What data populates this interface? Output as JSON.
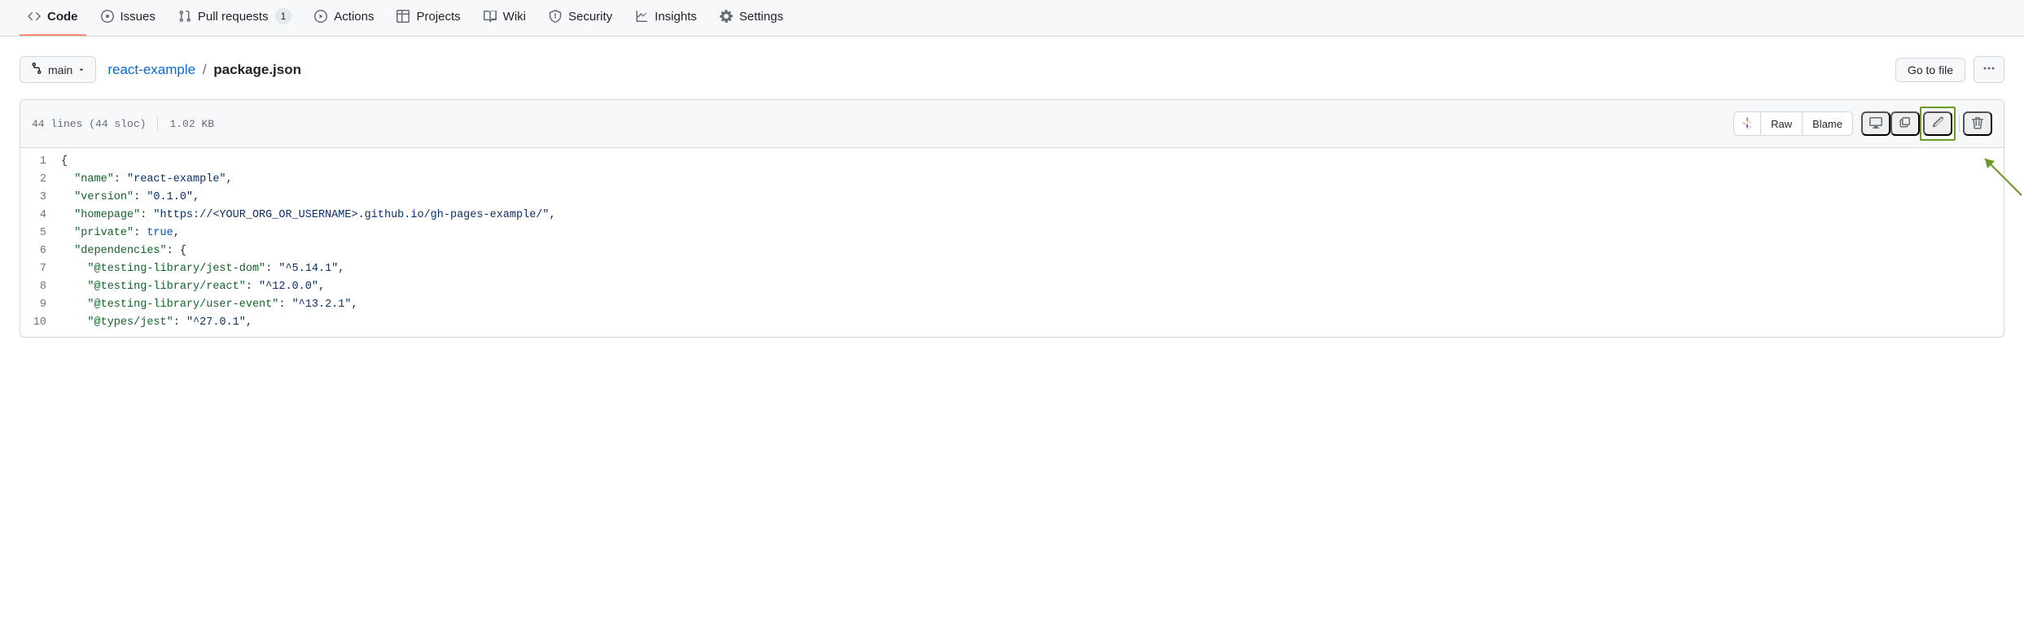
{
  "tabs": {
    "code": "Code",
    "issues": "Issues",
    "pulls": "Pull requests",
    "pulls_count": "1",
    "actions": "Actions",
    "projects": "Projects",
    "wiki": "Wiki",
    "security": "Security",
    "insights": "Insights",
    "settings": "Settings"
  },
  "branch": {
    "name": "main"
  },
  "breadcrumb": {
    "repo": "react-example",
    "sep": "/",
    "file": "package.json"
  },
  "actions_row": {
    "go_to_file": "Go to file"
  },
  "file_meta": {
    "lines_sloc": "44 lines (44 sloc)",
    "size": "1.02 KB"
  },
  "toolbar": {
    "raw": "Raw",
    "blame": "Blame"
  },
  "code": {
    "lines": [
      {
        "n": 1,
        "tokens": [
          {
            "t": "{",
            "c": "pl-p"
          }
        ]
      },
      {
        "n": 2,
        "tokens": [
          {
            "t": "  ",
            "c": "pl-p"
          },
          {
            "t": "\"name\"",
            "c": "pl-ent"
          },
          {
            "t": ": ",
            "c": "pl-p"
          },
          {
            "t": "\"react-example\"",
            "c": "pl-s"
          },
          {
            "t": ",",
            "c": "pl-p"
          }
        ]
      },
      {
        "n": 3,
        "tokens": [
          {
            "t": "  ",
            "c": "pl-p"
          },
          {
            "t": "\"version\"",
            "c": "pl-ent"
          },
          {
            "t": ": ",
            "c": "pl-p"
          },
          {
            "t": "\"0.1.0\"",
            "c": "pl-s"
          },
          {
            "t": ",",
            "c": "pl-p"
          }
        ]
      },
      {
        "n": 4,
        "tokens": [
          {
            "t": "  ",
            "c": "pl-p"
          },
          {
            "t": "\"homepage\"",
            "c": "pl-ent"
          },
          {
            "t": ": ",
            "c": "pl-p"
          },
          {
            "t": "\"https://<YOUR_ORG_OR_USERNAME>.github.io/gh-pages-example/\"",
            "c": "pl-s"
          },
          {
            "t": ",",
            "c": "pl-p"
          }
        ]
      },
      {
        "n": 5,
        "tokens": [
          {
            "t": "  ",
            "c": "pl-p"
          },
          {
            "t": "\"private\"",
            "c": "pl-ent"
          },
          {
            "t": ": ",
            "c": "pl-p"
          },
          {
            "t": "true",
            "c": "pl-c1"
          },
          {
            "t": ",",
            "c": "pl-p"
          }
        ]
      },
      {
        "n": 6,
        "tokens": [
          {
            "t": "  ",
            "c": "pl-p"
          },
          {
            "t": "\"dependencies\"",
            "c": "pl-ent"
          },
          {
            "t": ": {",
            "c": "pl-p"
          }
        ]
      },
      {
        "n": 7,
        "tokens": [
          {
            "t": "    ",
            "c": "pl-p"
          },
          {
            "t": "\"@testing-library/jest-dom\"",
            "c": "pl-ent"
          },
          {
            "t": ": ",
            "c": "pl-p"
          },
          {
            "t": "\"^5.14.1\"",
            "c": "pl-s"
          },
          {
            "t": ",",
            "c": "pl-p"
          }
        ]
      },
      {
        "n": 8,
        "tokens": [
          {
            "t": "    ",
            "c": "pl-p"
          },
          {
            "t": "\"@testing-library/react\"",
            "c": "pl-ent"
          },
          {
            "t": ": ",
            "c": "pl-p"
          },
          {
            "t": "\"^12.0.0\"",
            "c": "pl-s"
          },
          {
            "t": ",",
            "c": "pl-p"
          }
        ]
      },
      {
        "n": 9,
        "tokens": [
          {
            "t": "    ",
            "c": "pl-p"
          },
          {
            "t": "\"@testing-library/user-event\"",
            "c": "pl-ent"
          },
          {
            "t": ": ",
            "c": "pl-p"
          },
          {
            "t": "\"^13.2.1\"",
            "c": "pl-s"
          },
          {
            "t": ",",
            "c": "pl-p"
          }
        ]
      },
      {
        "n": 10,
        "tokens": [
          {
            "t": "    ",
            "c": "pl-p"
          },
          {
            "t": "\"@types/jest\"",
            "c": "pl-ent"
          },
          {
            "t": ": ",
            "c": "pl-p"
          },
          {
            "t": "\"^27.0.1\"",
            "c": "pl-s"
          },
          {
            "t": ",",
            "c": "pl-p"
          }
        ]
      }
    ]
  }
}
